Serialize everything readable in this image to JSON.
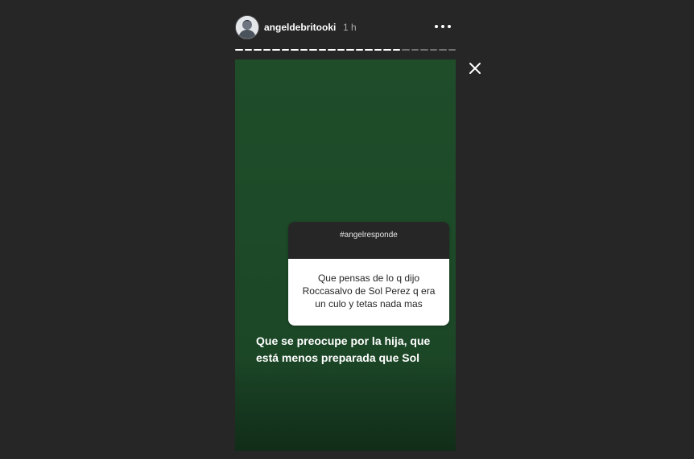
{
  "header": {
    "username": "angeldebritooki",
    "timestamp": "1 h",
    "avatar_icon": "user-avatar-icon",
    "more_icon": "more-options-icon"
  },
  "progress": {
    "segments_total": 24,
    "segments_done": 18
  },
  "close_icon": "close-icon",
  "story": {
    "background_color": "#1f4d2a",
    "question_sticker": {
      "title": "#angelresponde",
      "question": "Que pensas de lo q dijo Roccasalvo de Sol Perez q era un culo y tetas nada mas"
    },
    "answer_text": "Que se preocupe por la hija, que está menos preparada que Sol"
  }
}
